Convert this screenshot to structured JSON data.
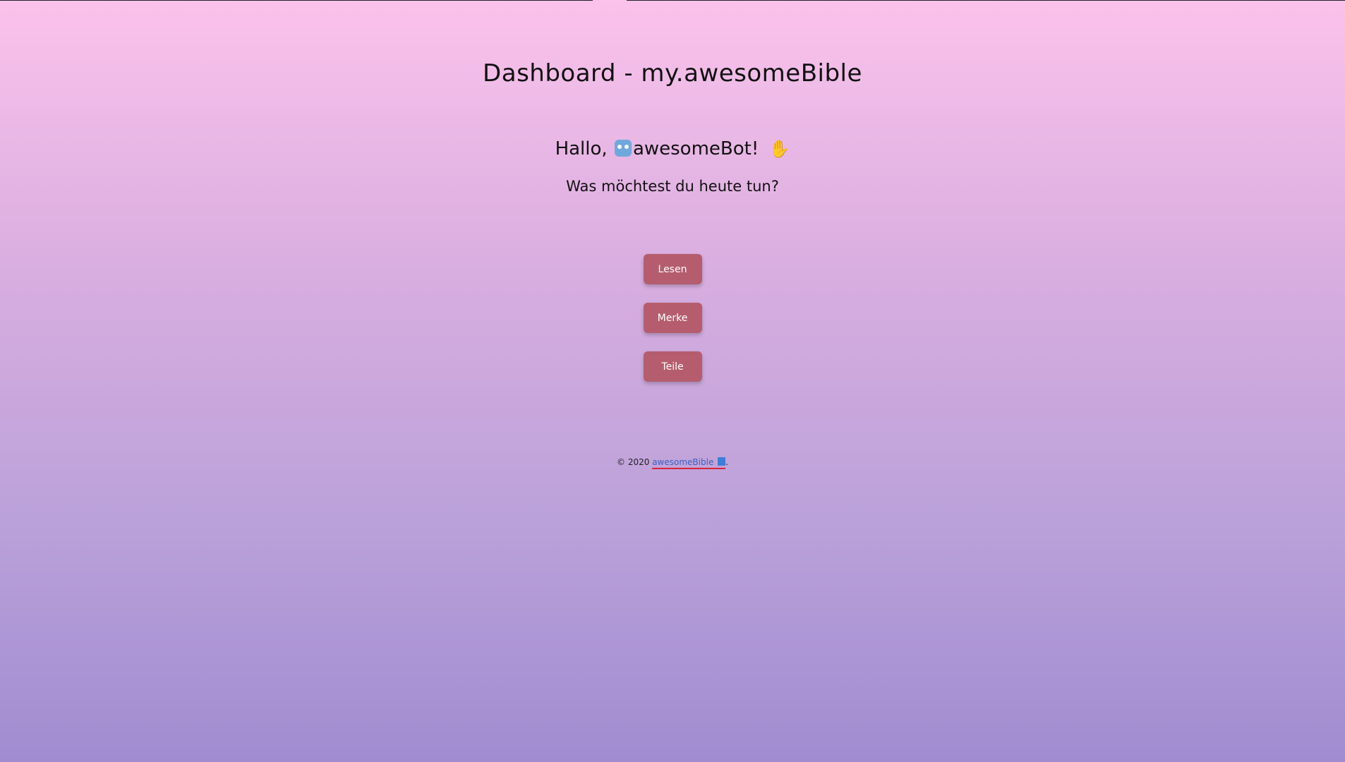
{
  "header": {
    "title": "Dashboard - my.awesomeBible"
  },
  "greeting": {
    "prefix": "Hallo,",
    "username": "awesomeBot!",
    "robot_icon": "robot-face-icon",
    "wave_icon": "waving-hand-icon"
  },
  "subtitle": "Was möchtest du heute tun?",
  "actions": [
    {
      "label": "Lesen"
    },
    {
      "label": "Merke"
    },
    {
      "label": "Teile"
    }
  ],
  "footer": {
    "copyright": "© 2020",
    "link_text": "awesomeBible",
    "book_icon": "book-icon",
    "suffix": "."
  },
  "colors": {
    "button_bg": "#b55d6e",
    "gradient_top": "#fbc2eb",
    "gradient_bottom": "#a18cd1",
    "link_underline": "#d6263b"
  }
}
